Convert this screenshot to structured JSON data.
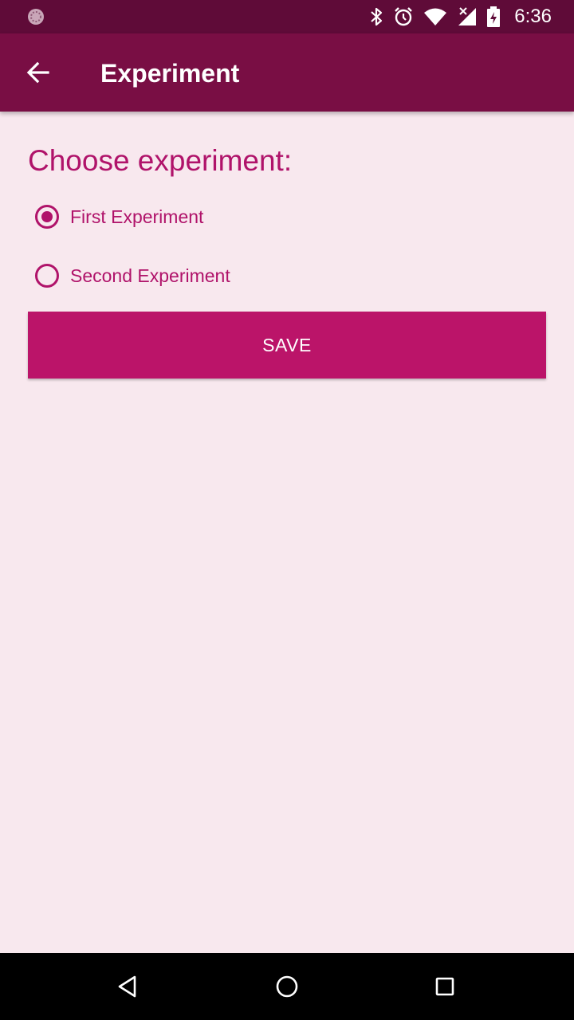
{
  "status_bar": {
    "time": "6:36",
    "icons": [
      "notification-dot-icon",
      "bluetooth-icon",
      "alarm-icon",
      "wifi-icon",
      "signal-icon",
      "battery-charging-icon"
    ]
  },
  "app_bar": {
    "title": "Experiment",
    "back_icon": "arrow-left-icon"
  },
  "content": {
    "heading": "Choose experiment:",
    "options": [
      {
        "label": "First Experiment",
        "checked": true
      },
      {
        "label": "Second Experiment",
        "checked": false
      }
    ],
    "save_label": "SAVE"
  },
  "nav_bar": {
    "icons": [
      "nav-back-icon",
      "nav-home-icon",
      "nav-recents-icon"
    ]
  },
  "colors": {
    "status_bar": "#5f0b38",
    "app_bar": "#790e44",
    "accent": "#b0136a",
    "button": "#bb1469",
    "background": "#f8e8ee"
  }
}
